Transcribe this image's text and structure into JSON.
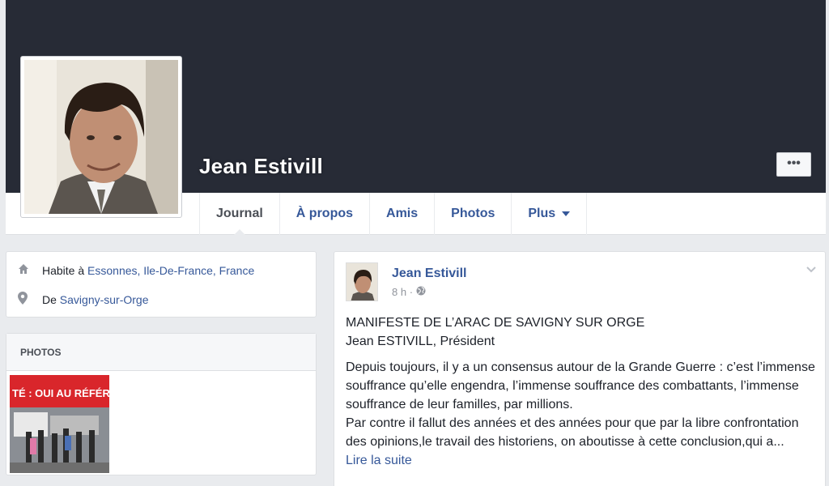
{
  "profile": {
    "name": "Jean Estivill",
    "more_label": "•••"
  },
  "tabs": [
    {
      "label": "Journal"
    },
    {
      "label": "À propos"
    },
    {
      "label": "Amis"
    },
    {
      "label": "Photos"
    },
    {
      "label": "Plus"
    }
  ],
  "intro": {
    "lives_prefix": "Habite à ",
    "lives_link": "Essonnes, Ile-De-France, France",
    "from_prefix": "De ",
    "from_link": "Savigny-sur-Orge"
  },
  "photos": {
    "heading": "PHOTOS",
    "banner_text": "TÉ : OUI AU RÉFÉREN"
  },
  "post": {
    "author": "Jean Estivill",
    "time": "8 h",
    "separator": "·",
    "title": "MANIFESTE DE L’ARAC DE SAVIGNY SUR ORGE",
    "subtitle": "Jean ESTIVILL, Président",
    "para1": "Depuis toujours, il y a un consensus autour de la Grande Guerre : c’est l’immense souffrance qu’elle engendra, l’immense souffrance des combattants, l’immense souffrance de leur familles, par millions.",
    "para2": "Par contre il fallut des années et des années pour que par la libre confrontation des opinions,le travail des historiens, on aboutisse à cette conclusion,qui a...",
    "read_more": "Lire la suite"
  },
  "colors": {
    "cover": "#272b36",
    "link": "#365899",
    "background": "#e9ebee"
  }
}
